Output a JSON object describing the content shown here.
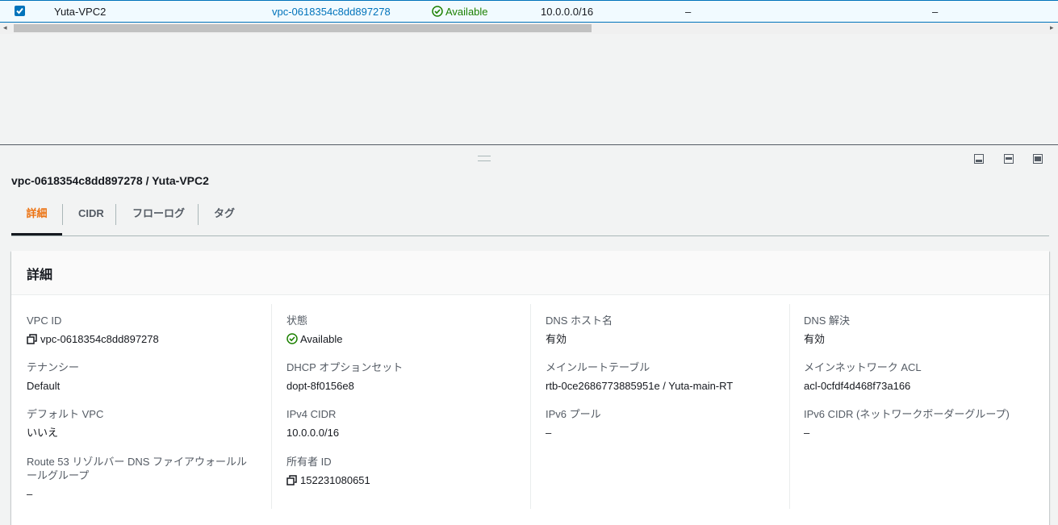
{
  "table_row": {
    "name": "Yuta-VPC2",
    "vpc_id": "vpc-0618354c8dd897278",
    "state": "Available",
    "ipv4_cidr": "10.0.0.0/16",
    "col5": "–",
    "col6": "–"
  },
  "scroll": {
    "left_arrow": "◂",
    "right_arrow": "▸"
  },
  "panel": {
    "title": "vpc-0618354c8dd897278 / Yuta-VPC2",
    "tabs": [
      {
        "label": "詳細"
      },
      {
        "label": "CIDR"
      },
      {
        "label": "フローログ"
      },
      {
        "label": "タグ"
      }
    ],
    "active_tab_color": "#ec7211"
  },
  "details": {
    "heading": "詳細",
    "col1": [
      {
        "label": "VPC ID",
        "value": "vpc-0618354c8dd897278"
      },
      {
        "label": "テナンシー",
        "value": "Default"
      },
      {
        "label": "デフォルト VPC",
        "value": "いいえ"
      },
      {
        "label": "Route 53 リゾルバー DNS ファイアウォールルールグループ",
        "value": "–"
      }
    ],
    "col2": [
      {
        "label": "状態",
        "value": "Available"
      },
      {
        "label": "DHCP オプションセット",
        "value": "dopt-8f0156e8"
      },
      {
        "label": "IPv4 CIDR",
        "value": "10.0.0.0/16"
      },
      {
        "label": "所有者 ID",
        "value": "152231080651"
      }
    ],
    "col3": [
      {
        "label": "DNS ホスト名",
        "value": "有効"
      },
      {
        "label": "メインルートテーブル",
        "value": "rtb-0ce2686773885951e / Yuta-main-RT"
      },
      {
        "label": "IPv6 プール",
        "value": "–"
      }
    ],
    "col4": [
      {
        "label": "DNS 解決",
        "value": "有効"
      },
      {
        "label": "メインネットワーク ACL",
        "value": "acl-0cfdf4d468f73a166"
      },
      {
        "label": "IPv6 CIDR (ネットワークボーダーグループ)",
        "value": "–"
      }
    ]
  },
  "colors": {
    "link": "#0073bb",
    "success": "#1d8102",
    "selected_row_bg": "#f1faff"
  }
}
